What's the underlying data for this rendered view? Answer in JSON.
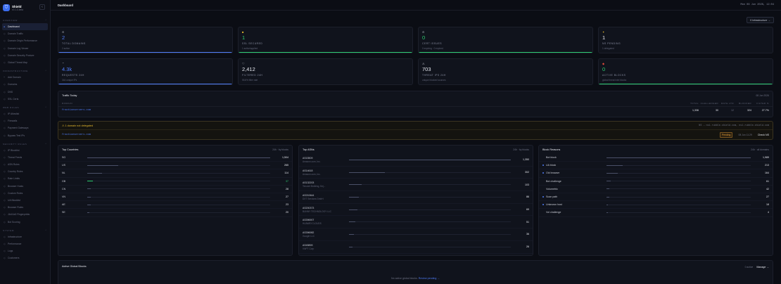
{
  "brand": {
    "name": "Shield",
    "version": "v0.1.0-beta"
  },
  "sidebar": {
    "sections": [
      {
        "title": "Overview",
        "items": [
          {
            "label": "Dashboard",
            "icon": "●",
            "active": true
          },
          {
            "label": "Domain Traffic",
            "icon": "◇"
          },
          {
            "label": "Domain Origin Performance",
            "icon": "◇"
          },
          {
            "label": "Domain Log Viewer",
            "icon": "◇"
          },
          {
            "label": "Domain Security Posture",
            "icon": "◇"
          },
          {
            "label": "Global Threat Map",
            "icon": "◇"
          }
        ]
      },
      {
        "title": "Infrastructure",
        "items": [
          {
            "label": "Add Domain",
            "icon": "+"
          },
          {
            "label": "Domains",
            "icon": "◇"
          },
          {
            "label": "DNS",
            "icon": "◇"
          },
          {
            "label": "SSL Certs",
            "icon": "◇"
          }
        ]
      },
      {
        "title": "Web Rules",
        "items": [
          {
            "label": "IP Allowlist",
            "icon": "◇"
          },
          {
            "label": "Firewalls",
            "icon": "◇"
          },
          {
            "label": "Payment Gateways",
            "icon": "◇"
          },
          {
            "label": "Bypass Test IPs",
            "icon": "◇"
          }
        ]
      },
      {
        "title": "Security Rules",
        "items": [
          {
            "label": "IP Blocklist",
            "icon": "◇"
          },
          {
            "label": "Threat Feeds",
            "icon": "◇"
          },
          {
            "label": "ASN Rules",
            "icon": "◇"
          },
          {
            "label": "Country Rules",
            "icon": "◇"
          },
          {
            "label": "Rate Limits",
            "icon": "◇"
          },
          {
            "label": "Browser Hosts",
            "icon": "◇"
          },
          {
            "label": "Custom Rules",
            "icon": "◇"
          },
          {
            "label": "UA Blocklist",
            "icon": "◇"
          },
          {
            "label": "Browser Rules",
            "icon": "◇"
          },
          {
            "label": "JA4/Ja3 Fingerprints",
            "icon": "◇"
          },
          {
            "label": "Bot Scoring",
            "icon": "◇"
          }
        ]
      },
      {
        "title": "System",
        "items": [
          {
            "label": "Infrastructure",
            "icon": "◇"
          },
          {
            "label": "Performance",
            "icon": "◇"
          },
          {
            "label": "Logs",
            "icon": "◇"
          },
          {
            "label": "Customers",
            "icon": "◇"
          }
        ]
      }
    ]
  },
  "topbar": {
    "title": "Dashboard",
    "datetime": "Mon 08 Jun 2026, 12:04"
  },
  "infra_button": "0 Infrastructure →",
  "stats": [
    {
      "icon": "⊙",
      "value": "2",
      "label": "Total Domains",
      "sub": "2 active",
      "color": "#4f7cf7",
      "bar": true
    },
    {
      "icon": "■",
      "value": "1",
      "label": "SSL Secured",
      "sub": "1 active/applied",
      "color": "#2ecc71",
      "bar": true,
      "icon_color": "#e5b82d"
    },
    {
      "icon": "⊙",
      "value": "0",
      "label": "Cert Issues",
      "sub": "0 expiring · 0 expired",
      "color": "#2ecc71",
      "bar": true
    },
    {
      "icon": "✦",
      "value": "1",
      "label": "NS Pending",
      "sub": "1 delegated",
      "color": "#e6e8ef",
      "bar": false,
      "icon_color": "#e5b82d"
    },
    {
      "icon": "⌃",
      "value": "4.3k",
      "label": "Requests 24h",
      "sub": "344 unique IPs",
      "color": "#4f7cf7",
      "bar": true
    },
    {
      "icon": "♡",
      "value": "2,412",
      "label": "Filtered 24h",
      "sub": "55.8% filter rate",
      "color": "#e6e8ef",
      "bar": false
    },
    {
      "icon": "⚠",
      "value": "703",
      "label": "Threat IPs 24h",
      "sub": "unique blocked sources",
      "color": "#e6e8ef",
      "bar": false
    },
    {
      "icon": "◆",
      "value": "0",
      "label": "Active Blocks",
      "sub": "global threat intel blocks",
      "color": "#2ecc71",
      "bar": true,
      "icon_color": "#e74c3c"
    }
  ],
  "traffic": {
    "title": "Traffic Today",
    "date": "08 Jun 2026",
    "columns": [
      "Domain",
      "Total",
      "Challenged",
      "Rate Ltd",
      "Blocked",
      "Filter %"
    ],
    "rows": [
      {
        "domain": "fractionservers.com",
        "total": "1,336",
        "challenged": "30",
        "rate": "12",
        "blocked": "324",
        "filter": "27.7%"
      }
    ]
  },
  "alert": {
    "title": "⚠ 1 domain not delegated",
    "ns": "NS → ns1.rubble-shield.com, ns1.rubble-shield.com",
    "domain": "fractionservers.com",
    "status": "Pending",
    "date": "08 Jun 11:29",
    "action": "Check NS"
  },
  "countries": {
    "title": "Top Countries",
    "meta": "24h · by blocks",
    "rows": [
      {
        "name": "SG",
        "value": "1,504",
        "pct": 100
      },
      {
        "name": "US",
        "value": "265",
        "pct": 17
      },
      {
        "name": "NL",
        "value": "114",
        "pct": 8
      },
      {
        "name": "GB",
        "value": "37",
        "pct": 3,
        "green": true
      },
      {
        "name": "CN",
        "value": "28",
        "pct": 2
      },
      {
        "name": "VN",
        "value": "27",
        "pct": 2
      },
      {
        "name": "AE",
        "value": "23",
        "pct": 2
      },
      {
        "name": "SE",
        "value": "20",
        "pct": 1
      }
    ]
  },
  "asns": {
    "title": "Top ASNs",
    "meta": "24h · by blocks",
    "rows": [
      {
        "asn": "AS15509",
        "org": "Amazon.com, Inc.",
        "value": "1,350",
        "pct": 100
      },
      {
        "asn": "AS14618",
        "org": "Amazon.com, Inc.",
        "value": "302",
        "pct": 22
      },
      {
        "asn": "AS132203",
        "org": "Tencent Building, Kej...",
        "value": "103",
        "pct": 8
      },
      {
        "asn": "AS210644",
        "org": "DXT Services GmbH",
        "value": "86",
        "pct": 6
      },
      {
        "asn": "AS200373",
        "org": "BUNNY TECHNOLOGY LLC",
        "value": "69",
        "pct": 5
      },
      {
        "asn": "AS396907",
        "org": "HUAWEI CLOUDS",
        "value": "51",
        "pct": 4
      },
      {
        "asn": "AS396982",
        "org": "Google LLC",
        "value": "36",
        "pct": 3
      },
      {
        "asn": "AS45899",
        "org": "VNPT Corp",
        "value": "26",
        "pct": 2
      }
    ]
  },
  "reasons": {
    "title": "Block Reasons",
    "meta": "24h · all domains",
    "rows": [
      {
        "name": "Bot block",
        "value": "1,989",
        "pct": 100,
        "dot": ""
      },
      {
        "name": "UA block",
        "value": "213",
        "pct": 11,
        "dot": "#4f7cf7"
      },
      {
        "name": "Old browser",
        "value": "164",
        "pct": 8,
        "dot": "#4f7cf7"
      },
      {
        "name": "Bot challenge",
        "value": "61",
        "pct": 3,
        "dot": ""
      },
      {
        "name": "Volumetric",
        "value": "42",
        "pct": 2,
        "dot": ""
      },
      {
        "name": "Scan path",
        "value": "27",
        "pct": 2,
        "dot": "#4f7cf7"
      },
      {
        "name": "Unknown host",
        "value": "18",
        "pct": 1,
        "dot": "#4f7cf7"
      },
      {
        "name": "Vol challenge",
        "value": "4",
        "pct": 1,
        "dot": ""
      }
    ]
  },
  "global_blocks": {
    "title": "Active Global Blocks",
    "meta": "0 active",
    "manage": "Manage →",
    "empty_text": "No active global blocks.",
    "empty_link": "Review pending →"
  }
}
